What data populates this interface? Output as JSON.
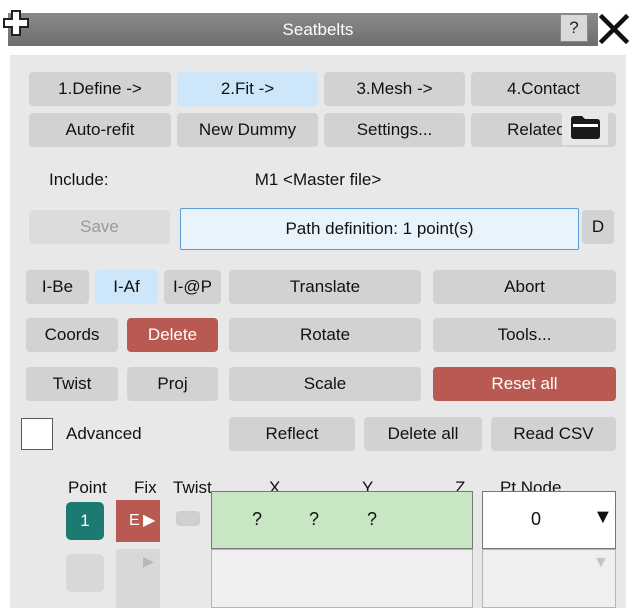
{
  "window": {
    "title": "Seatbelts",
    "help_label": "?"
  },
  "tabs": [
    "1.Define ->",
    "2.Fit ->",
    "3.Mesh ->",
    "4.Contact"
  ],
  "toolbar": [
    "Auto-refit",
    "New Dummy",
    "Settings...",
    "Related..."
  ],
  "include": {
    "label": "Include:",
    "value": "M1  <Master file>"
  },
  "path": {
    "save_label": "Save",
    "status": "Path definition: 1 point(s)",
    "d_label": "D"
  },
  "mode_buttons": {
    "ibe": "I-Be",
    "iaf": "I-Af",
    "iatp": "I-@P"
  },
  "actions": {
    "translate": "Translate",
    "abort": "Abort",
    "coords": "Coords",
    "delete": "Delete",
    "rotate": "Rotate",
    "tools": "Tools...",
    "twist": "Twist",
    "proj": "Proj",
    "scale": "Scale",
    "reset_all": "Reset all",
    "advanced": "Advanced",
    "reflect": "Reflect",
    "delete_all": "Delete all",
    "read_csv": "Read CSV"
  },
  "table": {
    "headers": {
      "point": "Point",
      "fix": "Fix",
      "twist": "Twist",
      "x": "X",
      "y": "Y",
      "z": "Z",
      "pt_node": "Pt Node"
    },
    "rows": [
      {
        "point": "1",
        "fix": "E",
        "x": "?",
        "y": "?",
        "z": "?",
        "pt_node": "0"
      }
    ]
  },
  "colors": {
    "active_tab": "#cde6fa",
    "danger": "#b85a52",
    "point_badge": "#1d7a70",
    "coord_field": "#c8e6c3"
  }
}
